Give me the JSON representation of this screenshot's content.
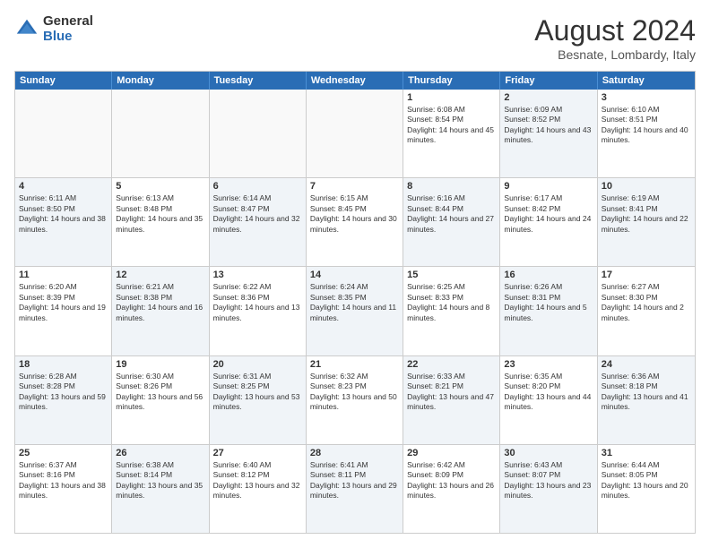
{
  "header": {
    "logo": {
      "general": "General",
      "blue": "Blue"
    },
    "title": "August 2024",
    "location": "Besnate, Lombardy, Italy"
  },
  "weekdays": [
    "Sunday",
    "Monday",
    "Tuesday",
    "Wednesday",
    "Thursday",
    "Friday",
    "Saturday"
  ],
  "rows": [
    [
      {
        "day": "",
        "text": "",
        "empty": true
      },
      {
        "day": "",
        "text": "",
        "empty": true
      },
      {
        "day": "",
        "text": "",
        "empty": true
      },
      {
        "day": "",
        "text": "",
        "empty": true
      },
      {
        "day": "1",
        "text": "Sunrise: 6:08 AM\nSunset: 8:54 PM\nDaylight: 14 hours and 45 minutes."
      },
      {
        "day": "2",
        "text": "Sunrise: 6:09 AM\nSunset: 8:52 PM\nDaylight: 14 hours and 43 minutes.",
        "shaded": true
      },
      {
        "day": "3",
        "text": "Sunrise: 6:10 AM\nSunset: 8:51 PM\nDaylight: 14 hours and 40 minutes."
      }
    ],
    [
      {
        "day": "4",
        "text": "Sunrise: 6:11 AM\nSunset: 8:50 PM\nDaylight: 14 hours and 38 minutes.",
        "shaded": true
      },
      {
        "day": "5",
        "text": "Sunrise: 6:13 AM\nSunset: 8:48 PM\nDaylight: 14 hours and 35 minutes."
      },
      {
        "day": "6",
        "text": "Sunrise: 6:14 AM\nSunset: 8:47 PM\nDaylight: 14 hours and 32 minutes.",
        "shaded": true
      },
      {
        "day": "7",
        "text": "Sunrise: 6:15 AM\nSunset: 8:45 PM\nDaylight: 14 hours and 30 minutes."
      },
      {
        "day": "8",
        "text": "Sunrise: 6:16 AM\nSunset: 8:44 PM\nDaylight: 14 hours and 27 minutes.",
        "shaded": true
      },
      {
        "day": "9",
        "text": "Sunrise: 6:17 AM\nSunset: 8:42 PM\nDaylight: 14 hours and 24 minutes."
      },
      {
        "day": "10",
        "text": "Sunrise: 6:19 AM\nSunset: 8:41 PM\nDaylight: 14 hours and 22 minutes.",
        "shaded": true
      }
    ],
    [
      {
        "day": "11",
        "text": "Sunrise: 6:20 AM\nSunset: 8:39 PM\nDaylight: 14 hours and 19 minutes."
      },
      {
        "day": "12",
        "text": "Sunrise: 6:21 AM\nSunset: 8:38 PM\nDaylight: 14 hours and 16 minutes.",
        "shaded": true
      },
      {
        "day": "13",
        "text": "Sunrise: 6:22 AM\nSunset: 8:36 PM\nDaylight: 14 hours and 13 minutes."
      },
      {
        "day": "14",
        "text": "Sunrise: 6:24 AM\nSunset: 8:35 PM\nDaylight: 14 hours and 11 minutes.",
        "shaded": true
      },
      {
        "day": "15",
        "text": "Sunrise: 6:25 AM\nSunset: 8:33 PM\nDaylight: 14 hours and 8 minutes."
      },
      {
        "day": "16",
        "text": "Sunrise: 6:26 AM\nSunset: 8:31 PM\nDaylight: 14 hours and 5 minutes.",
        "shaded": true
      },
      {
        "day": "17",
        "text": "Sunrise: 6:27 AM\nSunset: 8:30 PM\nDaylight: 14 hours and 2 minutes."
      }
    ],
    [
      {
        "day": "18",
        "text": "Sunrise: 6:28 AM\nSunset: 8:28 PM\nDaylight: 13 hours and 59 minutes.",
        "shaded": true
      },
      {
        "day": "19",
        "text": "Sunrise: 6:30 AM\nSunset: 8:26 PM\nDaylight: 13 hours and 56 minutes."
      },
      {
        "day": "20",
        "text": "Sunrise: 6:31 AM\nSunset: 8:25 PM\nDaylight: 13 hours and 53 minutes.",
        "shaded": true
      },
      {
        "day": "21",
        "text": "Sunrise: 6:32 AM\nSunset: 8:23 PM\nDaylight: 13 hours and 50 minutes."
      },
      {
        "day": "22",
        "text": "Sunrise: 6:33 AM\nSunset: 8:21 PM\nDaylight: 13 hours and 47 minutes.",
        "shaded": true
      },
      {
        "day": "23",
        "text": "Sunrise: 6:35 AM\nSunset: 8:20 PM\nDaylight: 13 hours and 44 minutes."
      },
      {
        "day": "24",
        "text": "Sunrise: 6:36 AM\nSunset: 8:18 PM\nDaylight: 13 hours and 41 minutes.",
        "shaded": true
      }
    ],
    [
      {
        "day": "25",
        "text": "Sunrise: 6:37 AM\nSunset: 8:16 PM\nDaylight: 13 hours and 38 minutes."
      },
      {
        "day": "26",
        "text": "Sunrise: 6:38 AM\nSunset: 8:14 PM\nDaylight: 13 hours and 35 minutes.",
        "shaded": true
      },
      {
        "day": "27",
        "text": "Sunrise: 6:40 AM\nSunset: 8:12 PM\nDaylight: 13 hours and 32 minutes."
      },
      {
        "day": "28",
        "text": "Sunrise: 6:41 AM\nSunset: 8:11 PM\nDaylight: 13 hours and 29 minutes.",
        "shaded": true
      },
      {
        "day": "29",
        "text": "Sunrise: 6:42 AM\nSunset: 8:09 PM\nDaylight: 13 hours and 26 minutes."
      },
      {
        "day": "30",
        "text": "Sunrise: 6:43 AM\nSunset: 8:07 PM\nDaylight: 13 hours and 23 minutes.",
        "shaded": true
      },
      {
        "day": "31",
        "text": "Sunrise: 6:44 AM\nSunset: 8:05 PM\nDaylight: 13 hours and 20 minutes."
      }
    ]
  ]
}
